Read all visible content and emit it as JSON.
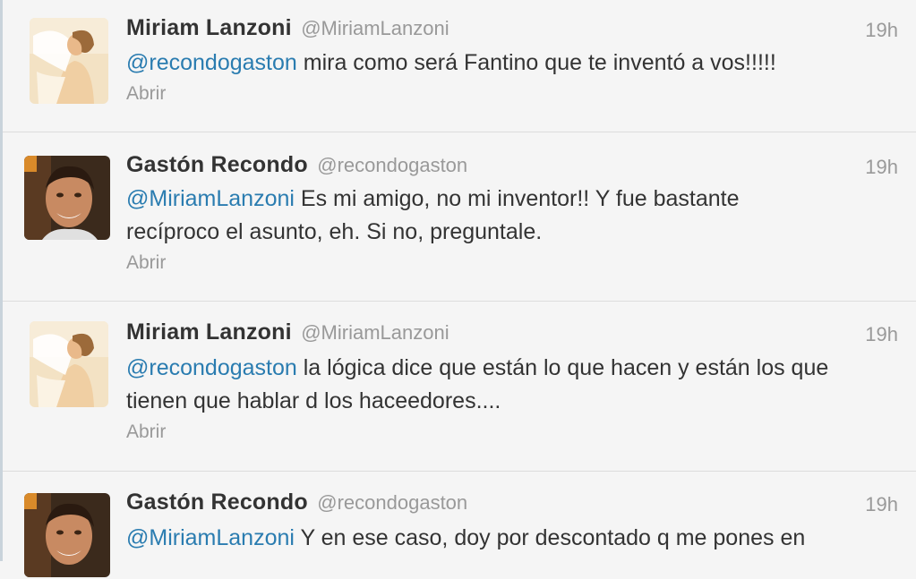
{
  "tweets": [
    {
      "fullname": "Miriam Lanzoni",
      "username": "@MiriamLanzoni",
      "time": "19h",
      "mention": "@recondogaston",
      "text": " mira como será Fantino que te inventó a vos!!!!!",
      "expand": "Abrir",
      "avatar_icon": "woman-avatar"
    },
    {
      "fullname": "Gastón Recondo",
      "username": "@recondogaston",
      "time": "19h",
      "mention": "@MiriamLanzoni",
      "text": " Es mi amigo, no mi inventor!! Y fue bastante recíproco el asunto, eh. Si no, preguntale.",
      "expand": "Abrir",
      "avatar_icon": "man-avatar"
    },
    {
      "fullname": "Miriam Lanzoni",
      "username": "@MiriamLanzoni",
      "time": "19h",
      "mention": "@recondogaston",
      "text": " la lógica dice que están lo que hacen y están los que tienen que hablar d los haceedores....",
      "expand": "Abrir",
      "avatar_icon": "woman-avatar"
    },
    {
      "fullname": "Gastón Recondo",
      "username": "@recondogaston",
      "time": "19h",
      "mention": "@MiriamLanzoni",
      "text": " Y en ese caso, doy por descontado q me pones en",
      "expand": "",
      "avatar_icon": "man-avatar"
    }
  ],
  "colors": {
    "background": "#f5f5f5",
    "mention": "#2a7cb0",
    "name": "#333333",
    "meta": "#999999",
    "divider": "#dcdcdc"
  }
}
